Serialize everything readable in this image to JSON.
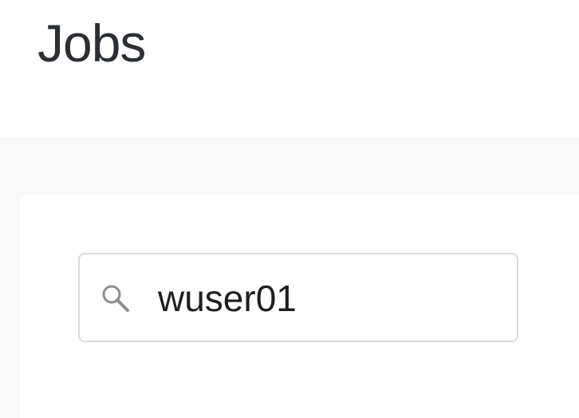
{
  "header": {
    "title": "Jobs"
  },
  "search": {
    "icon": "search-icon",
    "value": "wuser01",
    "placeholder": ""
  },
  "colors": {
    "title_text": "#2b2f33",
    "content_background": "#f8f8f8",
    "card_background": "#ffffff",
    "input_border": "#d9d9d9",
    "icon": "#8c8c8c",
    "input_text": "#1f1f1f"
  }
}
